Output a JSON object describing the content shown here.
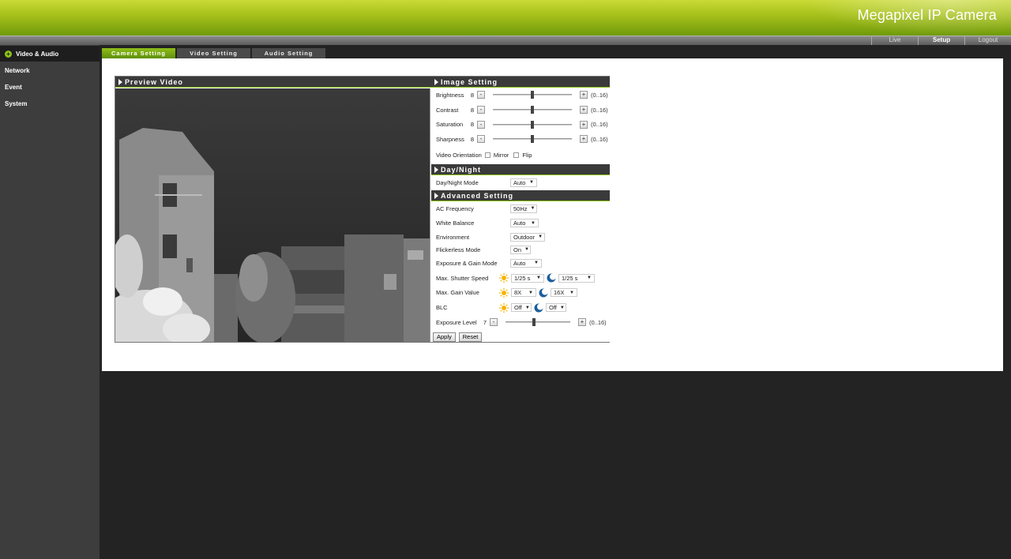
{
  "app": {
    "brand": "Megapixel IP Camera"
  },
  "topnav": [
    {
      "label": "Live"
    },
    {
      "label": "Setup",
      "active": true
    },
    {
      "label": "Logout"
    }
  ],
  "sidebar": {
    "items": [
      {
        "label": "Video & Audio",
        "active": true
      },
      {
        "label": "Network"
      },
      {
        "label": "Event"
      },
      {
        "label": "System"
      }
    ]
  },
  "tabs": [
    {
      "label": "Camera Setting",
      "active": true
    },
    {
      "label": "Video Setting"
    },
    {
      "label": "Audio Setting"
    }
  ],
  "preview": {
    "title": "Preview Video"
  },
  "image_setting": {
    "title": "Image Setting",
    "sliders": [
      {
        "label": "Brightness",
        "value": "8",
        "range": "(0..16)",
        "level": 0.5
      },
      {
        "label": "Contrast",
        "value": "8",
        "range": "(0..16)",
        "level": 0.5
      },
      {
        "label": "Saturation",
        "value": "8",
        "range": "(0..16)",
        "level": 0.5
      },
      {
        "label": "Sharpness",
        "value": "8",
        "range": "(0..16)",
        "level": 0.5
      }
    ],
    "minus": "-",
    "plus": "+",
    "orientation": {
      "label": "Video Orientation",
      "mirror": "Mirror",
      "flip": "Flip"
    }
  },
  "day_night": {
    "title": "Day/Night",
    "mode_label": "Day/Night Mode",
    "mode_value": "Auto"
  },
  "advanced": {
    "title": "Advanced Setting",
    "ac_frequency": {
      "label": "AC Frequency",
      "value": "50Hz"
    },
    "white_balance": {
      "label": "White Balance",
      "value": "Auto"
    },
    "environment": {
      "label": "Environment",
      "value": "Outdoor"
    },
    "flickerless": {
      "label": "Flickerless Mode",
      "value": "On"
    },
    "exposure_gain": {
      "label": "Exposure & Gain Mode",
      "value": "Auto"
    },
    "shutter": {
      "label": "Max. Shutter Speed",
      "day": "1/25 s",
      "night": "1/25 s"
    },
    "gain": {
      "label": "Max. Gain Value",
      "day": "8X",
      "night": "16X"
    },
    "blc": {
      "label": "BLC",
      "day": "Off",
      "night": "Off"
    },
    "exposure_level": {
      "label": "Exposure Level",
      "value": "7",
      "range": "(0..16)",
      "level": 0.44
    }
  },
  "actions": {
    "apply": "Apply",
    "reset": "Reset"
  },
  "colors": {
    "accent": "#8dc21a",
    "header_top": "#c9da36",
    "header_bottom": "#6f9a0a",
    "dark_bg": "#232323",
    "sidebar_bg": "#3d3d3d"
  }
}
